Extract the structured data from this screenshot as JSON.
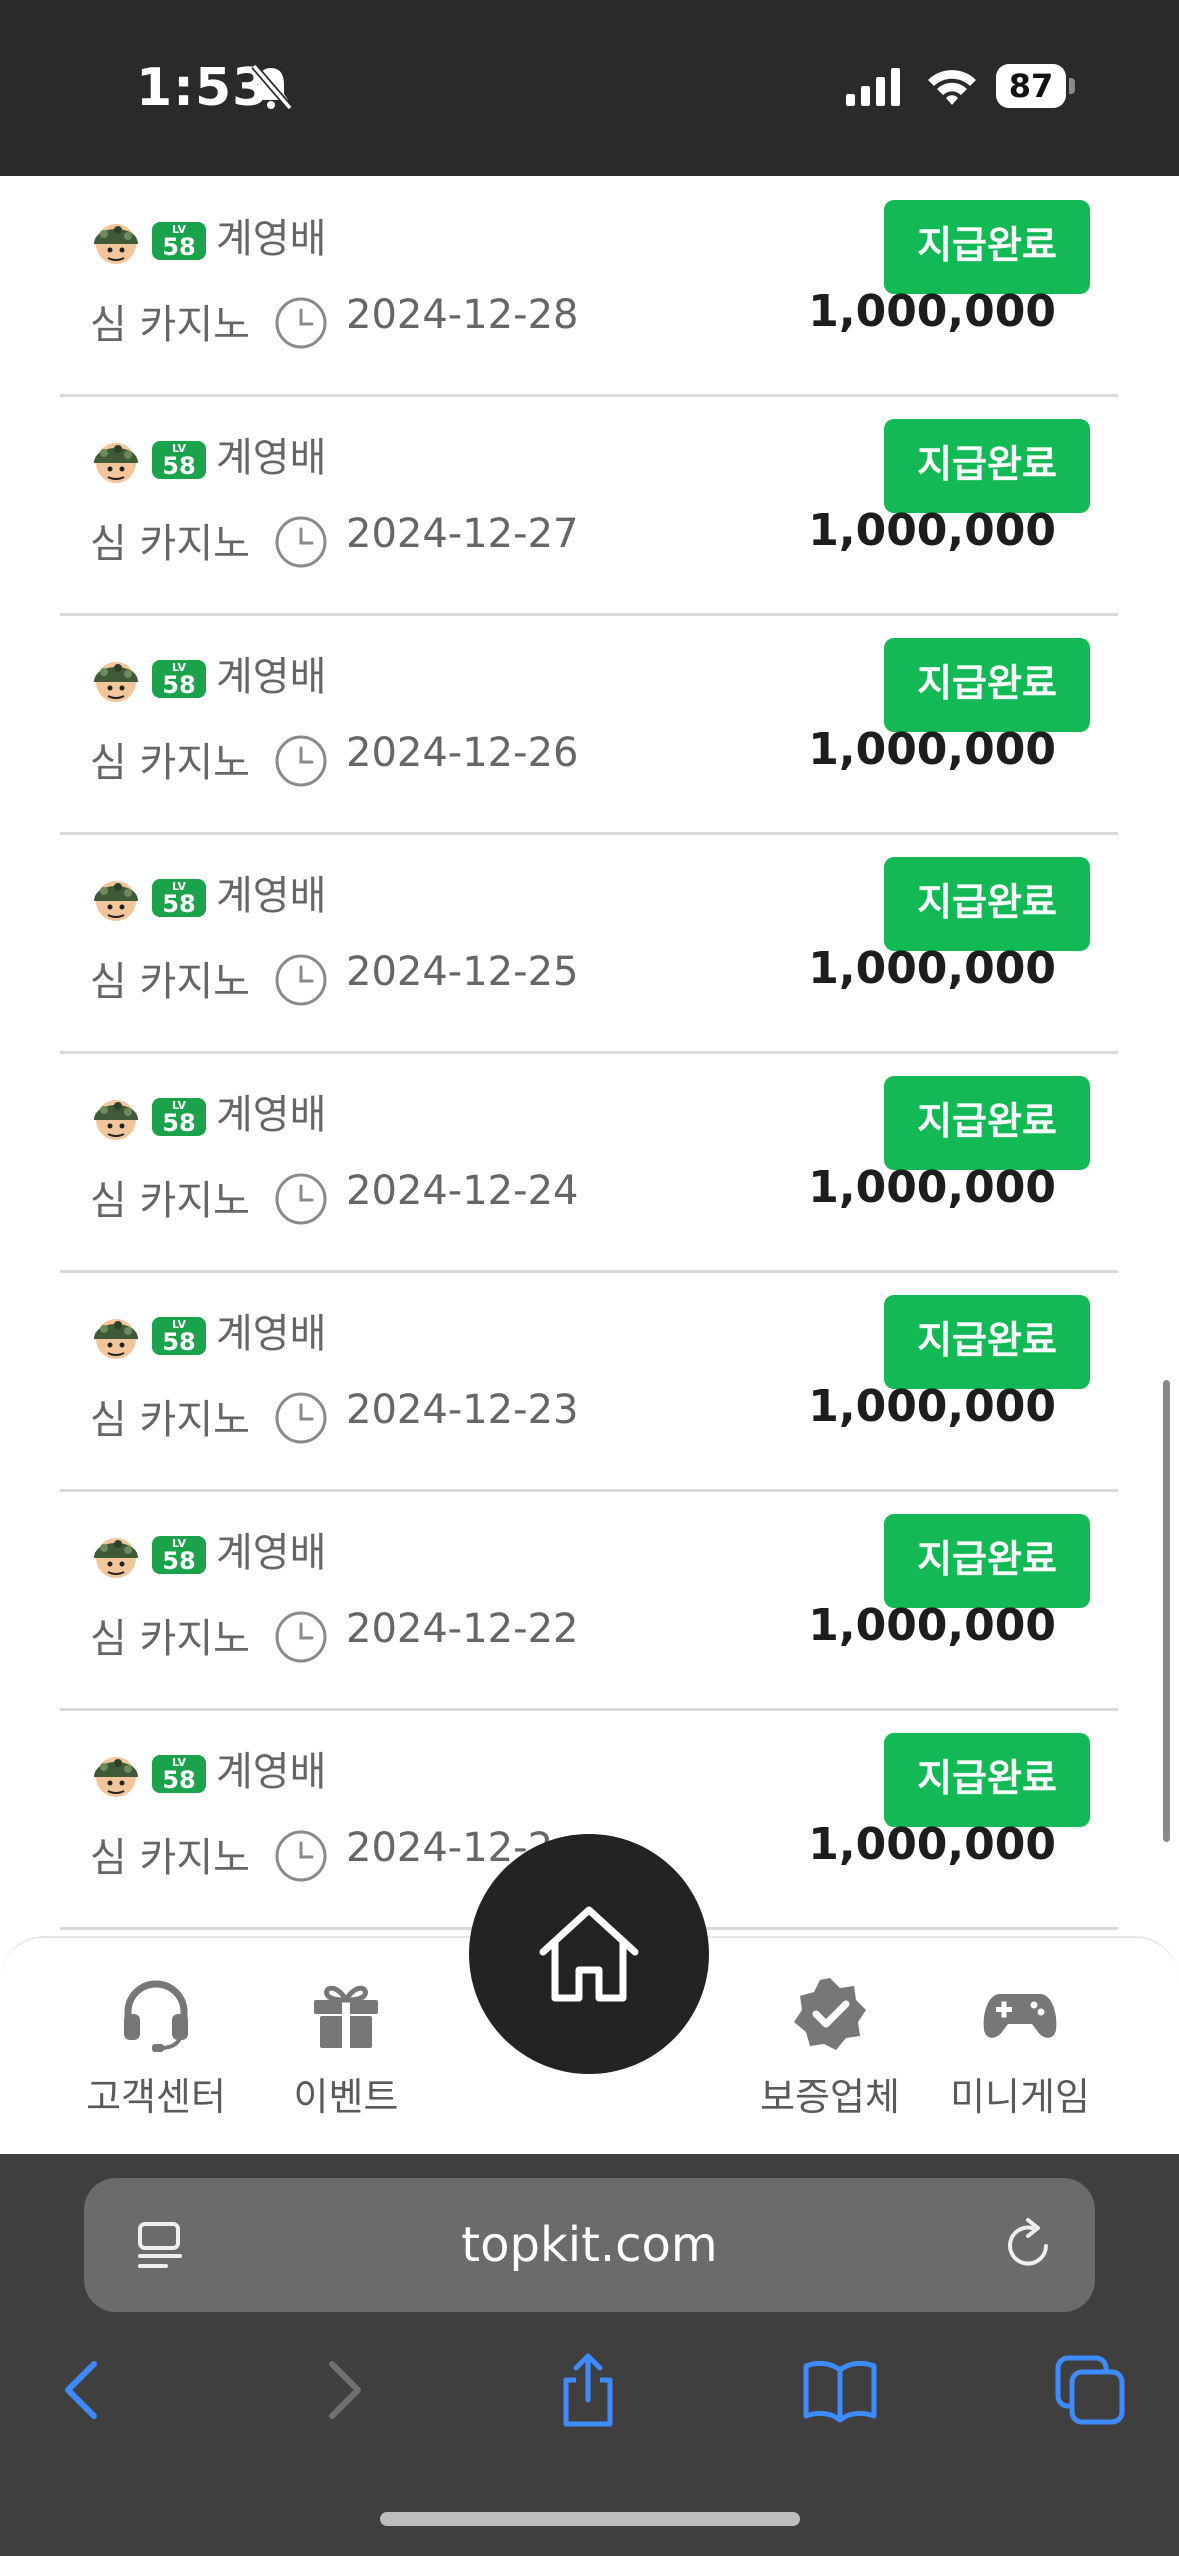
{
  "status_bar": {
    "time": "1:53",
    "battery": "87"
  },
  "rows": [
    {
      "username": "계영배",
      "level": "58",
      "level_prefix": "LV",
      "site": "심 카지노",
      "date": "2024-12-28",
      "status": "지급완료",
      "amount": "1,000,000"
    },
    {
      "username": "계영배",
      "level": "58",
      "level_prefix": "LV",
      "site": "심 카지노",
      "date": "2024-12-27",
      "status": "지급완료",
      "amount": "1,000,000"
    },
    {
      "username": "계영배",
      "level": "58",
      "level_prefix": "LV",
      "site": "심 카지노",
      "date": "2024-12-26",
      "status": "지급완료",
      "amount": "1,000,000"
    },
    {
      "username": "계영배",
      "level": "58",
      "level_prefix": "LV",
      "site": "심 카지노",
      "date": "2024-12-25",
      "status": "지급완료",
      "amount": "1,000,000"
    },
    {
      "username": "계영배",
      "level": "58",
      "level_prefix": "LV",
      "site": "심 카지노",
      "date": "2024-12-24",
      "status": "지급완료",
      "amount": "1,000,000"
    },
    {
      "username": "계영배",
      "level": "58",
      "level_prefix": "LV",
      "site": "심 카지노",
      "date": "2024-12-23",
      "status": "지급완료",
      "amount": "1,000,000"
    },
    {
      "username": "계영배",
      "level": "58",
      "level_prefix": "LV",
      "site": "심 카지노",
      "date": "2024-12-22",
      "status": "지급완료",
      "amount": "1,000,000"
    },
    {
      "username": "계영배",
      "level": "58",
      "level_prefix": "LV",
      "site": "심 카지노",
      "date": "2024-12-2",
      "status": "지급완료",
      "amount": "1,000,000"
    }
  ],
  "bottom_nav": {
    "items": [
      {
        "label": "고객센터",
        "icon": "headset-icon"
      },
      {
        "label": "이벤트",
        "icon": "gift-icon"
      },
      {
        "label": "보증업체",
        "icon": "verified-badge-icon"
      },
      {
        "label": "미니게임",
        "icon": "gamepad-icon"
      }
    ],
    "home_icon": "home-icon"
  },
  "browser": {
    "url": "topkit.com"
  },
  "colors": {
    "status_green": "#12b955",
    "level_badge": "#1aa34a",
    "ios_blue": "#3d8bff"
  }
}
